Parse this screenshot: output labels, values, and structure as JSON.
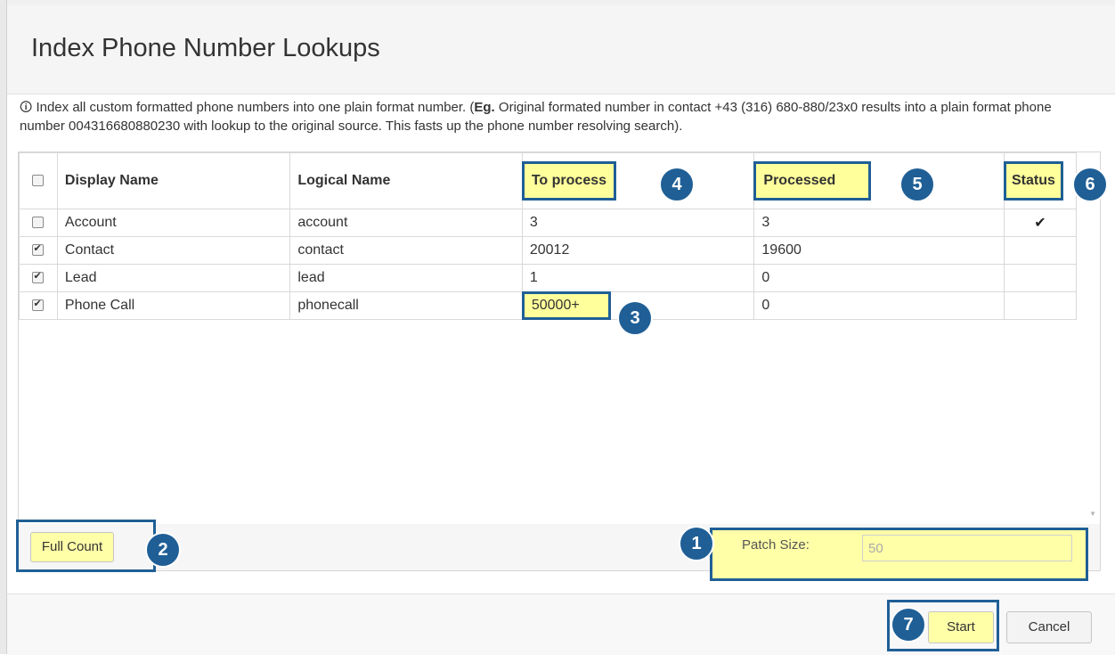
{
  "dialog": {
    "title": "Index Phone Number Lookups",
    "info_icon": "info-circle-icon",
    "info_text_part1": "Index all custom formatted phone numbers into one plain format number. (",
    "info_bold": "Eg.",
    "info_text_part2": " Original formated number in contact +43 (316) 680-880/23x0 results into a plain format phone number 004316680880230 with lookup to the original source. This fasts up the phone number resolving search)."
  },
  "table": {
    "headers": [
      "Display Name",
      "Logical Name",
      "To process",
      "Processed",
      "Status"
    ],
    "rows": [
      {
        "checked": false,
        "display": "Account",
        "logical": "account",
        "to_process": "3",
        "processed": "3",
        "status": "✔"
      },
      {
        "checked": true,
        "display": "Contact",
        "logical": "contact",
        "to_process": "20012",
        "processed": "19600",
        "status": ""
      },
      {
        "checked": true,
        "display": "Lead",
        "logical": "lead",
        "to_process": "1",
        "processed": "0",
        "status": ""
      },
      {
        "checked": true,
        "display": "Phone Call",
        "logical": "phonecall",
        "to_process": "50000+",
        "processed": "0",
        "status": ""
      }
    ]
  },
  "footer": {
    "full_count_label": "Full Count",
    "patch_size_label": "Patch Size:",
    "patch_size_value": "50"
  },
  "buttons": {
    "start_label": "Start",
    "cancel_label": "Cancel"
  },
  "badges": [
    "1",
    "2",
    "3",
    "4",
    "5",
    "6",
    "7"
  ],
  "colors": {
    "highlight": "#ffffa8",
    "badge": "#1f5f96"
  }
}
